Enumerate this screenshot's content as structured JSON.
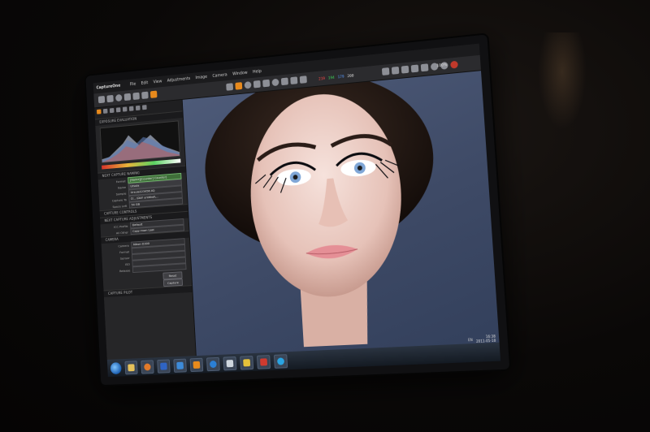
{
  "app": {
    "title": "CaptureOne"
  },
  "menu": [
    "File",
    "Edit",
    "View",
    "Adjustments",
    "Image",
    "Camera",
    "Window",
    "Help"
  ],
  "readout": {
    "r": "219",
    "g": "194",
    "b": "179",
    "l": "200"
  },
  "zoom": "100%",
  "panel": {
    "sections": {
      "exposure": "EXPOSURE EVALUATION",
      "next_capture": "NEXT CAPTURE NAMING",
      "capture_controls": "CAPTURE CONTROLS",
      "adjustments": "NEXT CAPTURE ADJUSTMENTS",
      "camera": "CAMERA",
      "capture_pilot": "CAPTURE PILOT"
    },
    "naming": [
      {
        "label": "Format",
        "value": "[Name][Counter] Counter]",
        "style": "green"
      },
      {
        "label": "Name",
        "value": "Ursula",
        "style": "normal"
      },
      {
        "label": "Sample",
        "value": "Ursula123456.IIQ",
        "style": "dark"
      },
      {
        "label": "Capture To",
        "value": "D:...\\DAY untitled\\...",
        "style": "dark"
      },
      {
        "label": "Space Left",
        "value": "54 GB",
        "style": "dark"
      }
    ],
    "adjust": [
      {
        "label": "ICC Profile",
        "value": "Default",
        "style": "dark"
      },
      {
        "label": "All Other",
        "value": "Copy From Last",
        "style": "dark"
      }
    ],
    "camera": [
      {
        "label": "Camera",
        "value": "Nikon D300",
        "style": "dark"
      },
      {
        "label": "Format",
        "value": "",
        "style": "dark"
      },
      {
        "label": "Sensor",
        "value": "",
        "style": "dark"
      },
      {
        "label": "ISO",
        "value": "",
        "style": "dark"
      },
      {
        "label": "Release",
        "value": "",
        "style": "dark"
      }
    ],
    "buttons": {
      "reset": "Reset",
      "capture": "Capture"
    }
  },
  "tray": {
    "time": "16:38",
    "date": "2011-05-18",
    "lang": "EN"
  },
  "colors": {
    "accent": "#e88a1c",
    "panel": "#262628",
    "viewer": "#4d5a78"
  },
  "icons": [
    "start-orb",
    "folder-icon",
    "firefox-icon",
    "word-icon",
    "photoshop-icon",
    "app-icon",
    "chrome-icon",
    "alien-icon",
    "python-icon",
    "media-icon",
    "skype-icon"
  ]
}
